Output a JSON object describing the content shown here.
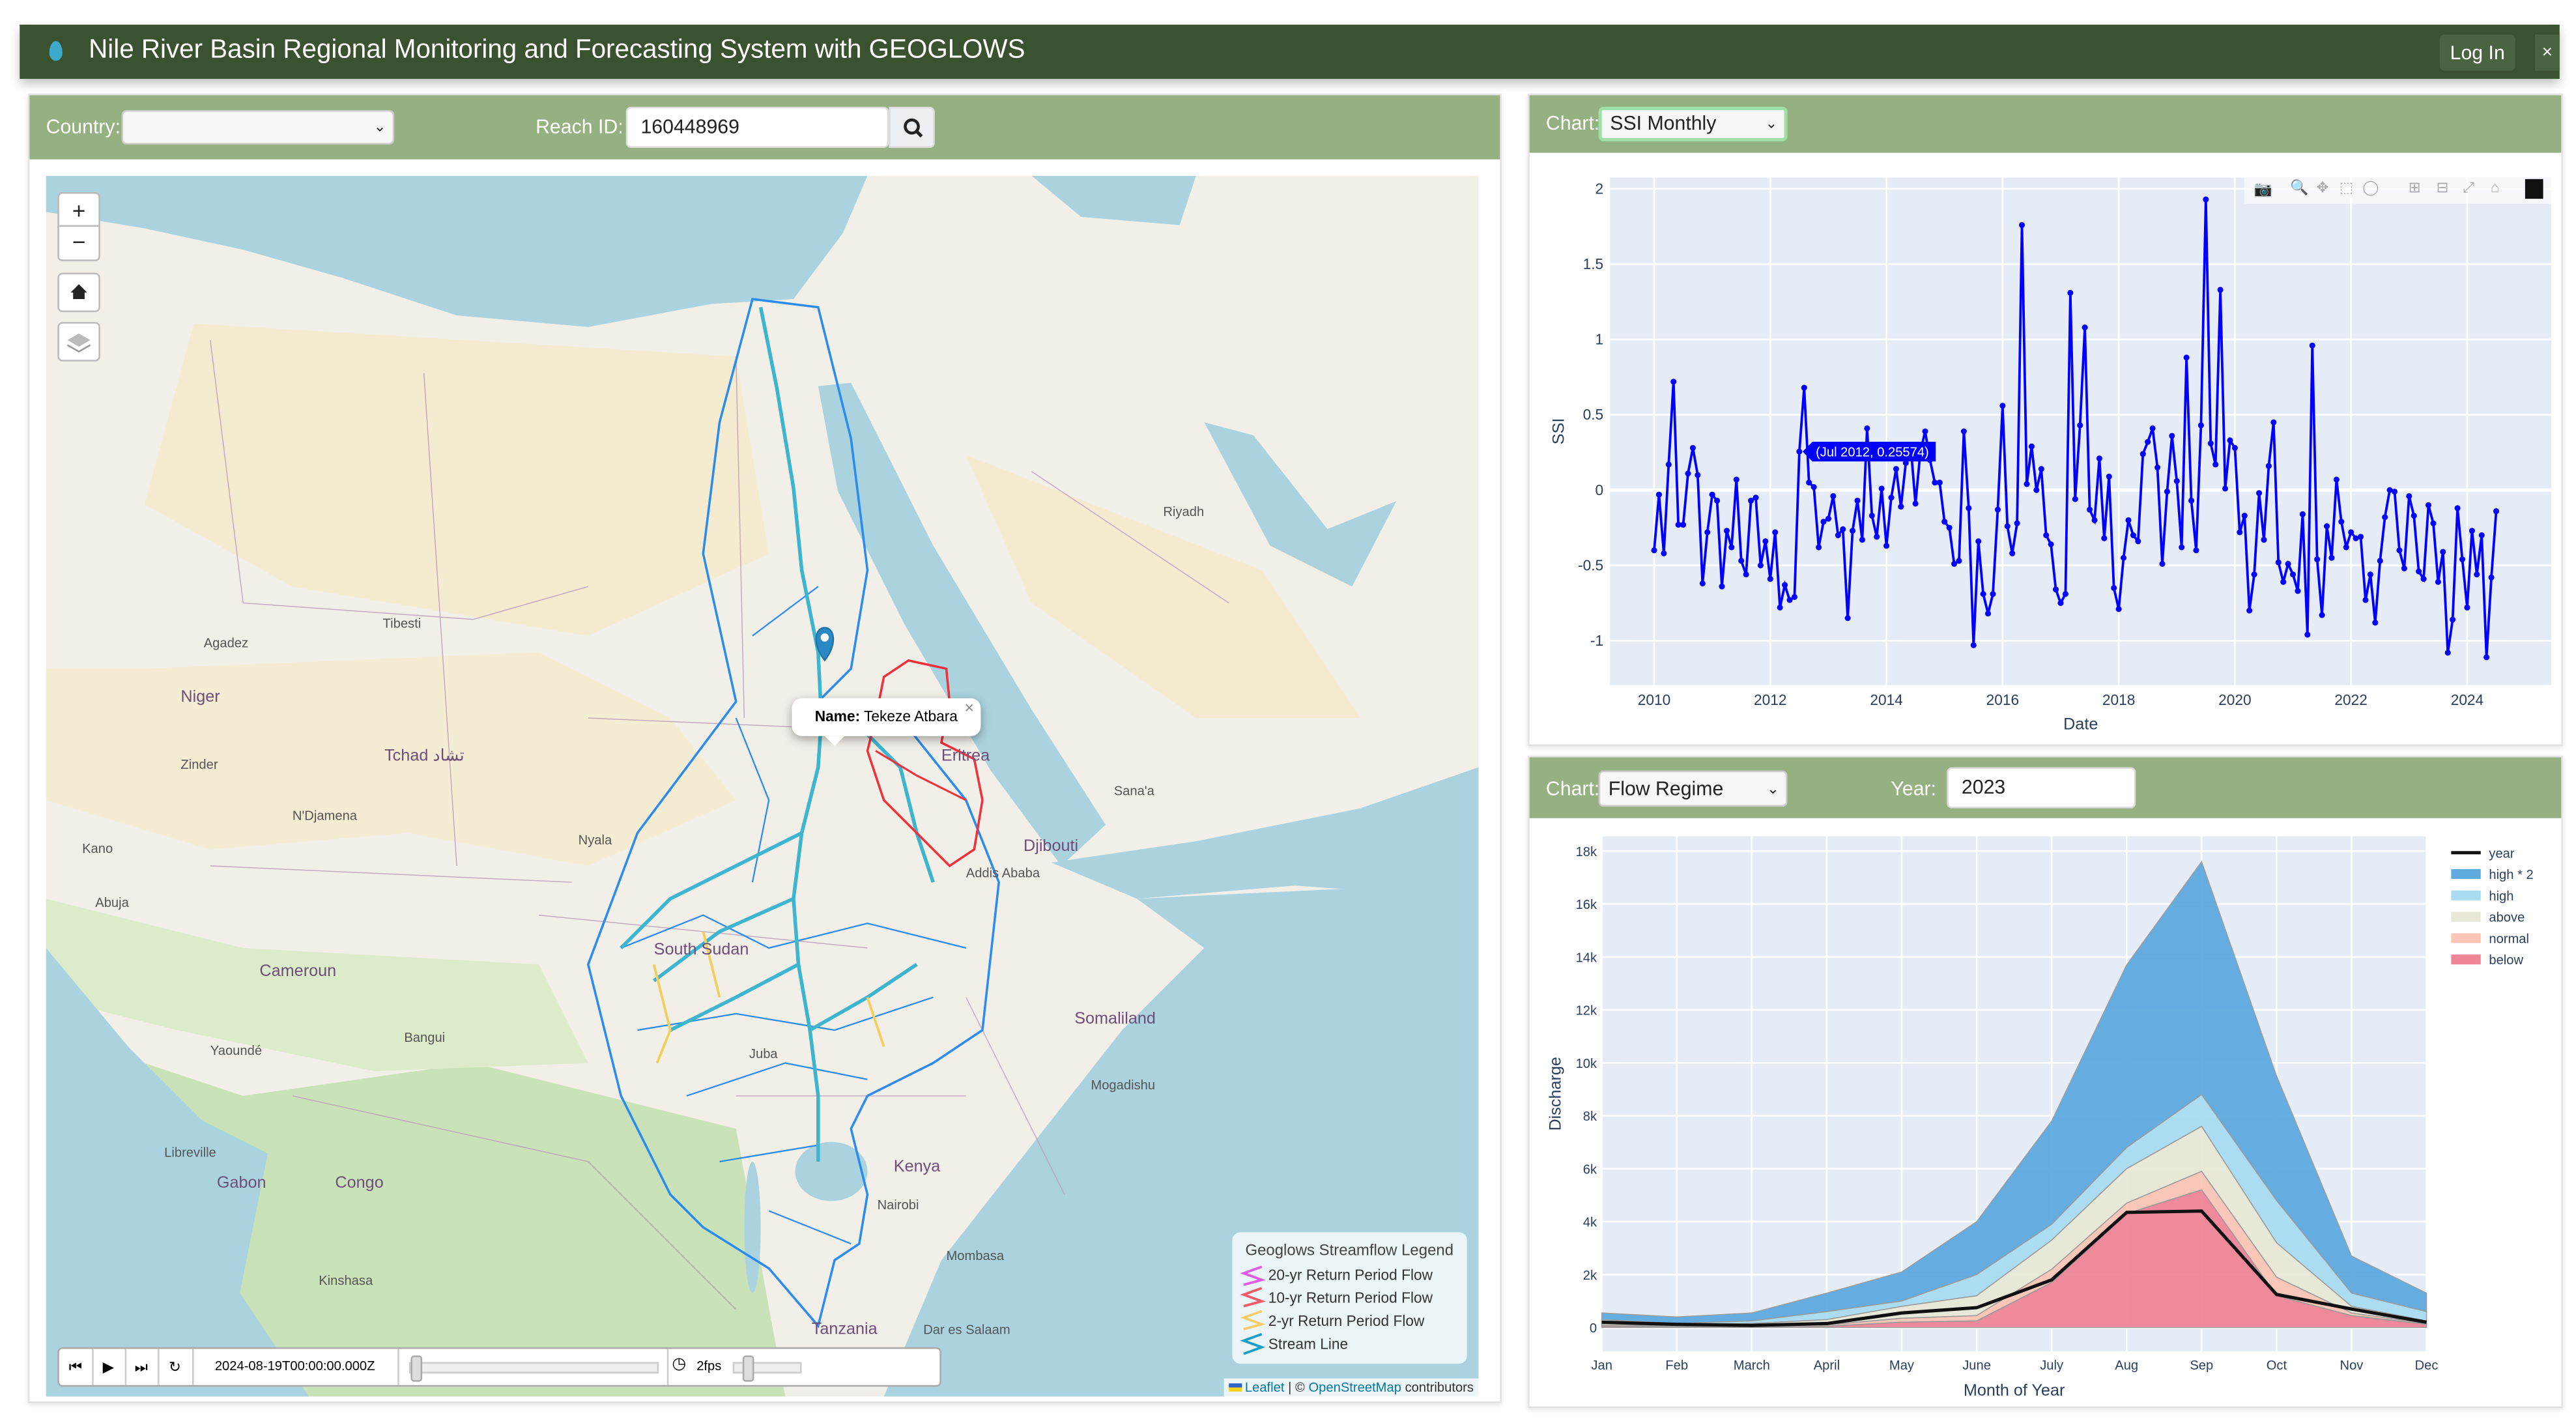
{
  "header": {
    "title": "Nile River Basin Regional Monitoring and Forecasting System with GEOGLOWS",
    "login_label": "Log In",
    "close_label": "×"
  },
  "map_panel": {
    "country_label": "Country:",
    "country_value": "",
    "reach_label": "Reach ID:",
    "reach_value": "160448969",
    "zoom_in": "+",
    "zoom_out": "−",
    "popup": {
      "name_label": "Name:",
      "name_value": "Tekeze Atbara",
      "close": "×"
    },
    "legend": {
      "title": "Geoglows Streamflow Legend",
      "items": [
        {
          "label": "20-yr Return Period Flow",
          "color": "#e05ce8"
        },
        {
          "label": "10-yr Return Period Flow",
          "color": "#f25a6a"
        },
        {
          "label": "2-yr Return Period Flow",
          "color": "#f7cf6a"
        },
        {
          "label": "Stream Line",
          "color": "#1a9fc8"
        }
      ]
    },
    "attribution": {
      "leaflet": "Leaflet",
      "sep": "| ©",
      "osm": "OpenStreetMap",
      "contrib": "contributors"
    },
    "time": {
      "timestamp": "2024-08-19T00:00:00.000Z",
      "fps": "2fps"
    },
    "places": [
      "Niger",
      "Tchad تشاد",
      "Cameroun",
      "Congo",
      "Gabon",
      "Kenya",
      "Tanzania",
      "Somaliland",
      "Djibouti",
      "Eritrea",
      "Kinshasa",
      "Nairobi",
      "Mombasa",
      "Juba",
      "N'Djamena",
      "Bangui",
      "Mogadishu",
      "South Sudan",
      "Agadez",
      "Zinder",
      "Kano",
      "Abuja",
      "Yaoundé",
      "Libreville",
      "Dar es Salaam",
      "Addis Ababa",
      "Sana'a",
      "Riyadh",
      "Tibesti",
      "Nyala"
    ]
  },
  "ssi_panel": {
    "chart_label": "Chart:",
    "chart_value": "SSI Monthly",
    "tooltip": "(Jul 2012, 0.25574)"
  },
  "flow_panel": {
    "chart_label": "Chart:",
    "chart_value": "Flow Regime",
    "year_label": "Year:",
    "year_value": "2023"
  },
  "chart_data": [
    {
      "type": "line",
      "title": "",
      "xlabel": "Date",
      "ylabel": "SSI",
      "start": "2010-01",
      "frequency": "monthly",
      "color": "#0000ff",
      "xlim": [
        2009.24,
        2025.45
      ],
      "ylim": [
        -1.295,
        2.076
      ],
      "xticks": [
        "2010",
        "2012",
        "2014",
        "2016",
        "2018",
        "2020",
        "2022",
        "2024"
      ],
      "yticks": [
        "2",
        "1.5",
        "1",
        "0.5",
        "0",
        "-0.5",
        "-1"
      ],
      "values": [
        -0.4,
        -0.03,
        -0.42,
        0.17,
        0.72,
        -0.23,
        -0.23,
        0.11,
        0.28,
        0.1,
        -0.62,
        -0.28,
        -0.03,
        -0.07,
        -0.64,
        -0.27,
        -0.38,
        0.07,
        -0.47,
        -0.56,
        -0.07,
        -0.05,
        -0.5,
        -0.34,
        -0.59,
        -0.28,
        -0.78,
        -0.63,
        -0.73,
        -0.71,
        0.25574,
        0.68,
        0.05,
        0.02,
        -0.38,
        -0.21,
        -0.19,
        -0.04,
        -0.3,
        -0.26,
        -0.85,
        -0.27,
        -0.07,
        -0.33,
        0.41,
        -0.17,
        -0.31,
        0.01,
        -0.37,
        -0.05,
        0.14,
        -0.11,
        0.18,
        0.3,
        -0.09,
        0.25,
        0.39,
        0.2,
        0.05,
        0.05,
        -0.21,
        -0.25,
        -0.49,
        -0.47,
        0.39,
        -0.12,
        -1.03,
        -0.34,
        -0.69,
        -0.82,
        -0.69,
        -0.13,
        0.56,
        -0.24,
        -0.42,
        -0.22,
        1.76,
        0.04,
        0.29,
        0.0,
        0.14,
        -0.3,
        -0.36,
        -0.66,
        -0.75,
        -0.69,
        1.31,
        -0.06,
        0.43,
        1.08,
        -0.13,
        -0.2,
        0.21,
        -0.32,
        0.09,
        -0.65,
        -0.79,
        -0.45,
        -0.2,
        -0.3,
        -0.34,
        0.24,
        0.32,
        0.41,
        0.15,
        -0.49,
        -0.01,
        0.36,
        0.06,
        -0.38,
        0.88,
        -0.07,
        -0.4,
        0.43,
        1.93,
        0.31,
        0.17,
        1.33,
        0.01,
        0.33,
        0.28,
        -0.28,
        -0.17,
        -0.8,
        -0.56,
        -0.02,
        -0.33,
        0.16,
        0.45,
        -0.48,
        -0.61,
        -0.49,
        -0.56,
        -0.67,
        -0.16,
        -0.96,
        0.96,
        -0.46,
        -0.83,
        -0.24,
        -0.45,
        0.07,
        -0.21,
        -0.38,
        -0.28,
        -0.32,
        -0.31,
        -0.73,
        -0.56,
        -0.88,
        -0.47,
        -0.18,
        0.0,
        -0.01,
        -0.4,
        -0.52,
        -0.04,
        -0.17,
        -0.54,
        -0.59,
        -0.1,
        -0.22,
        -0.61,
        -0.41,
        -1.08,
        -0.86,
        -0.12,
        -0.46,
        -0.78,
        -0.27,
        -0.56,
        -0.3,
        -1.11,
        -0.58,
        -0.14
      ]
    },
    {
      "type": "area",
      "title": "",
      "xlabel": "Month of Year",
      "ylabel": "Discharge",
      "categories": [
        "Jan",
        "Feb",
        "March",
        "April",
        "May",
        "June",
        "July",
        "Aug",
        "Sep",
        "Oct",
        "Nov",
        "Dec"
      ],
      "ylim": [
        -900,
        18560
      ],
      "yticks": [
        "0",
        "2k",
        "4k",
        "6k",
        "8k",
        "10k",
        "12k",
        "14k",
        "16k",
        "18k"
      ],
      "legend_position": "right",
      "bands": [
        {
          "name": "high * 2",
          "color": "#5faadf",
          "upper": [
            550,
            400,
            550,
            1300,
            2100,
            4000,
            7800,
            13700,
            17600,
            9500,
            2700,
            1300
          ]
        },
        {
          "name": "high",
          "color": "#a9dcf1",
          "upper": [
            300,
            150,
            250,
            600,
            1000,
            2000,
            3900,
            6800,
            8800,
            4800,
            1300,
            600
          ]
        },
        {
          "name": "above",
          "color": "#e9e8d8",
          "upper": [
            200,
            100,
            150,
            300,
            800,
            1200,
            3300,
            6000,
            7600,
            3200,
            800,
            250
          ]
        },
        {
          "name": "normal",
          "color": "#fbc6b6",
          "upper": [
            100,
            60,
            50,
            100,
            350,
            450,
            2200,
            4700,
            5900,
            1900,
            550,
            150
          ]
        },
        {
          "name": "below",
          "color": "#f08598",
          "upper": [
            50,
            30,
            20,
            50,
            200,
            250,
            1700,
            4300,
            5200,
            1200,
            450,
            120
          ]
        }
      ],
      "series": [
        {
          "name": "year",
          "color": "#111111",
          "values": [
            200,
            120,
            80,
            150,
            550,
            750,
            1800,
            4350,
            4400,
            1250,
            700,
            200
          ]
        }
      ]
    }
  ]
}
